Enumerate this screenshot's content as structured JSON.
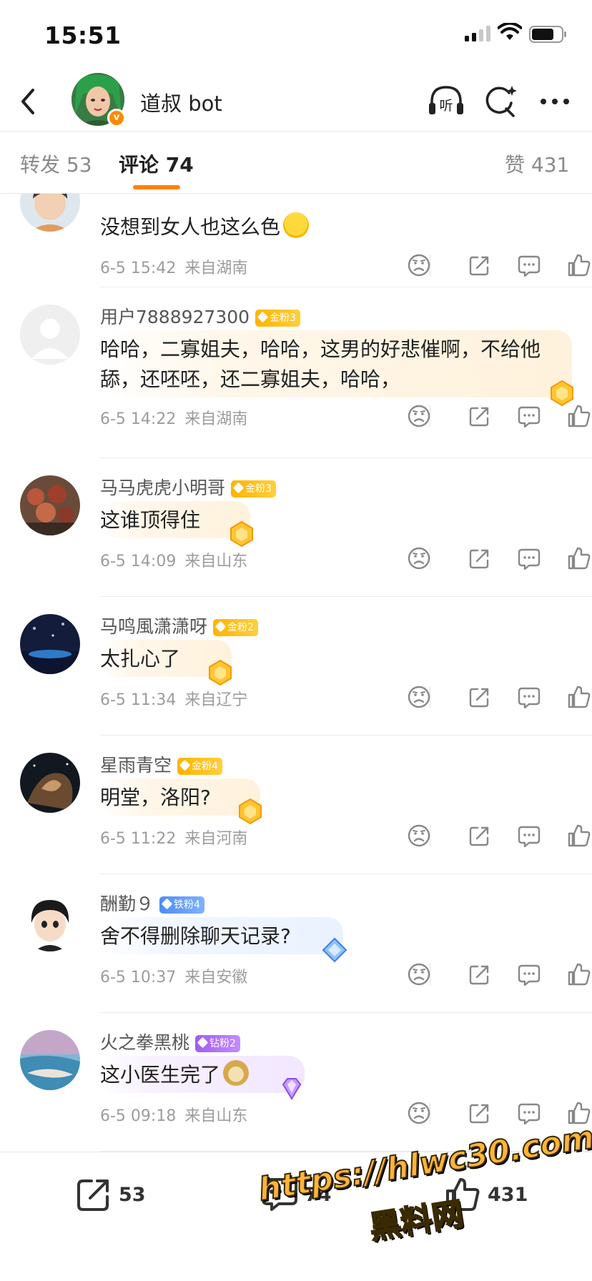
{
  "status_bar": {
    "time": "15:51"
  },
  "header": {
    "name": "道叔 bot",
    "listen_label": "听"
  },
  "tabs": {
    "repost": "转发 53",
    "comments": "评论 74",
    "likes": "赞 431"
  },
  "comments": [
    {
      "user": "",
      "text": "没想到女人也这么色",
      "emoji": "laughing-crying-emoji",
      "time": "6-5 15:42",
      "location": "来自湖南"
    },
    {
      "user": "用户7888927300",
      "badge": "金粉3",
      "badge_type": "gold",
      "text": "哈哈，二寡姐夫，哈哈，这男的好悲催啊，不给他舔，还呸呸，还二寡姐夫，哈哈，",
      "time": "6-5 14:22",
      "location": "来自湖南"
    },
    {
      "user": "马马虎虎小明哥",
      "badge": "金粉3",
      "badge_type": "gold",
      "text": "这谁顶得住",
      "time": "6-5 14:09",
      "location": "来自山东"
    },
    {
      "user": "马鸣風潇潇呀",
      "badge": "金粉2",
      "badge_type": "gold",
      "text": "太扎心了",
      "time": "6-5 11:34",
      "location": "来自辽宁"
    },
    {
      "user": "星雨青空",
      "badge": "金粉4",
      "badge_type": "gold",
      "text": "明堂，洛阳?",
      "time": "6-5 11:22",
      "location": "来自河南"
    },
    {
      "user": "酬勤９",
      "badge": "铁粉4",
      "badge_type": "iron",
      "text": "舍不得删除聊天记录?",
      "time": "6-5 10:37",
      "location": "来自安徽"
    },
    {
      "user": "火之拳黑桃",
      "badge": "钻粉2",
      "badge_type": "diamond",
      "text": "这小医生完了",
      "emoji": "doge-emoji",
      "time": "6-5 09:18",
      "location": "来自山东"
    }
  ],
  "bottom_bar": {
    "repost_count": "53",
    "comment_count": "74",
    "like_count": "431"
  },
  "watermark": {
    "url": "https://hlwc30.com",
    "name": "黑料网"
  },
  "colors": {
    "accent": "#ff8200",
    "gold_badge": "#ffb300",
    "iron_badge": "#4f8df5",
    "diamond_badge": "#a25cf0",
    "watermark": "#ffb43b"
  }
}
